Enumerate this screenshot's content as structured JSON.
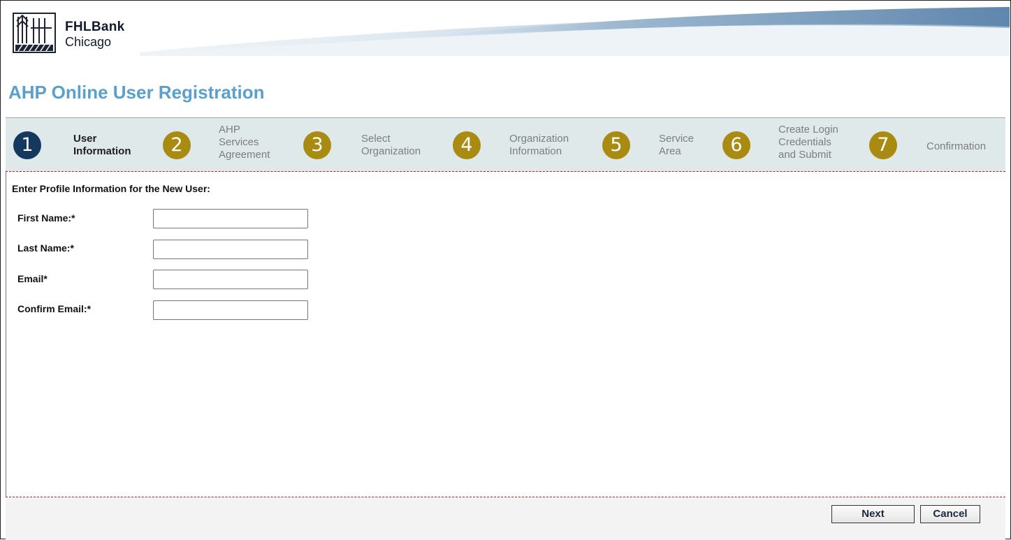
{
  "brand": {
    "name": "FHLBank",
    "city": "Chicago"
  },
  "page_title": "AHP Online User Registration",
  "steps": [
    {
      "number": "1",
      "label": "User\nInformation",
      "state": "active"
    },
    {
      "number": "2",
      "label": "AHP\nServices\nAgreement",
      "state": "inactive"
    },
    {
      "number": "3",
      "label": "Select\nOrganization",
      "state": "inactive"
    },
    {
      "number": "4",
      "label": "Organization\nInformation",
      "state": "inactive"
    },
    {
      "number": "5",
      "label": "Service\nArea",
      "state": "inactive"
    },
    {
      "number": "6",
      "label": "Create Login\nCredentials\nand Submit",
      "state": "inactive"
    },
    {
      "number": "7",
      "label": "Confirmation",
      "state": "inactive"
    }
  ],
  "form": {
    "heading": "Enter Profile Information for the New User:",
    "fields": [
      {
        "label": "First Name:*",
        "value": ""
      },
      {
        "label": "Last Name:*",
        "value": ""
      },
      {
        "label": "Email*",
        "value": ""
      },
      {
        "label": "Confirm Email:*",
        "value": ""
      }
    ]
  },
  "buttons": {
    "next": "Next",
    "cancel": "Cancel"
  },
  "colors": {
    "title": "#5aa0cd",
    "active_step": "#15395e",
    "inactive_step": "#a88b10",
    "divider": "#b22222"
  },
  "icons": {
    "logo": "fhlbank-building-logo"
  }
}
